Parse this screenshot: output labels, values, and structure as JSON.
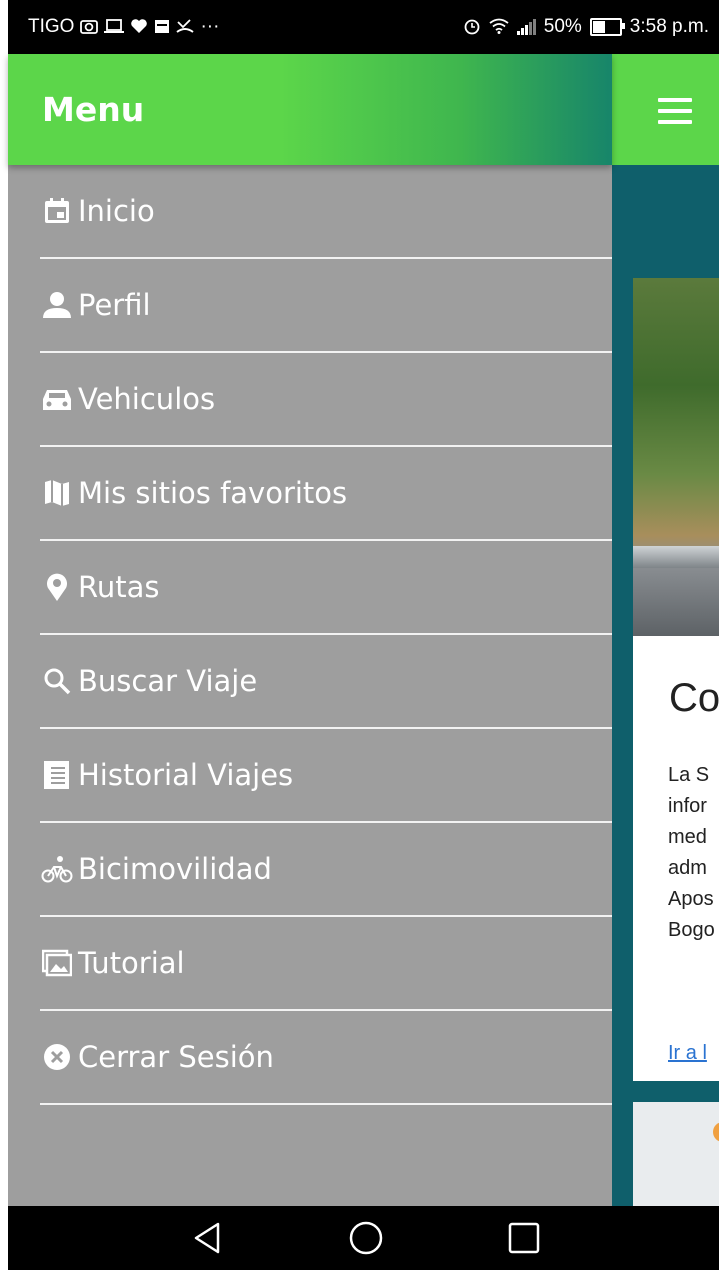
{
  "status_bar": {
    "carrier": "TIGO",
    "notification_icons": [
      "camera-icon",
      "laptop-icon",
      "heart-icon",
      "calendar-icon",
      "missed-call-icon"
    ],
    "more": "···",
    "battery": "50%",
    "battery_level": 0.5,
    "time": "3:58 p.m."
  },
  "drawer": {
    "title": "Menu",
    "items": [
      {
        "label": "Inicio",
        "icon": "calendar-icon"
      },
      {
        "label": "Perfil",
        "icon": "person-icon"
      },
      {
        "label": "Vehiculos",
        "icon": "car-icon"
      },
      {
        "label": "Mis sitios favoritos",
        "icon": "map-icon"
      },
      {
        "label": "Rutas",
        "icon": "location-pin-icon"
      },
      {
        "label": "Buscar Viaje",
        "icon": "search-icon"
      },
      {
        "label": "Historial Viajes",
        "icon": "list-icon"
      },
      {
        "label": "Bicimovilidad",
        "icon": "bicycle-icon"
      },
      {
        "label": "Tutorial",
        "icon": "images-icon"
      },
      {
        "label": "Cerrar Sesión",
        "icon": "close-circle-icon"
      }
    ]
  },
  "background_page": {
    "menu_icon": "hamburger-icon",
    "card_title": "Co",
    "card_lines": [
      "La S",
      "infor",
      "med",
      "adm",
      "Apos",
      "Bogo"
    ],
    "card_link": "Ir a l"
  },
  "nav_bar": {
    "buttons": [
      "back-icon",
      "home-icon",
      "recents-icon"
    ]
  },
  "colors": {
    "header_green": "#5cd64a",
    "drawer_gray": "#9e9e9e",
    "background_teal": "#0f5f6b",
    "link_blue": "#2a73d1"
  }
}
